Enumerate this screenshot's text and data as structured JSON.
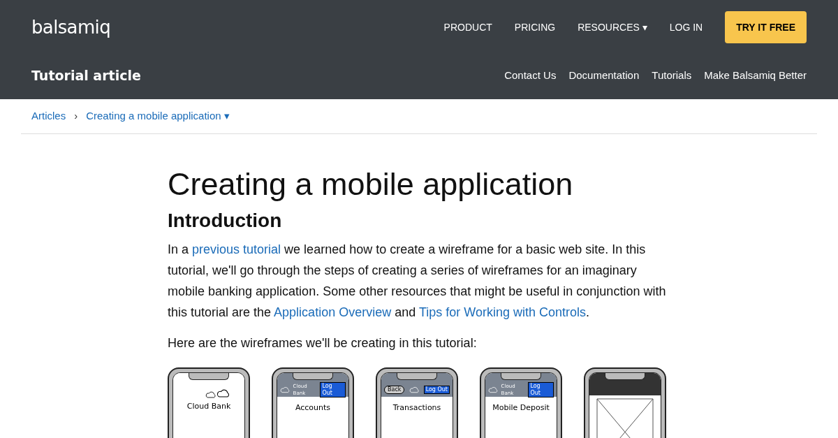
{
  "header": {
    "logo": "balsamiq",
    "nav": [
      "PRODUCT",
      "PRICING",
      "RESOURCES ▾",
      "LOG IN"
    ],
    "cta": "TRY IT FREE"
  },
  "subheader": {
    "title": "Tutorial article",
    "links": [
      "Contact Us",
      "Documentation",
      "Tutorials",
      "Make Balsamiq Better"
    ]
  },
  "breadcrumb": {
    "items": [
      "Articles",
      "Creating a mobile application ▾"
    ],
    "separator": "›"
  },
  "article": {
    "title": "Creating a mobile application",
    "heading": "Introduction",
    "paragraphs": [
      [
        {
          "kind": "text",
          "text": "In a "
        },
        {
          "kind": "link",
          "text": "previous tutorial"
        },
        {
          "kind": "text",
          "text": " we learned how to create a wireframe for a basic web site. In this tutorial, we'll go through the steps of creating a series of wireframes for an imaginary mobile banking application. Some other resources that might be useful in conjunction with this tutorial are the "
        },
        {
          "kind": "link",
          "text": "Application Overview"
        },
        {
          "kind": "text",
          "text": " and "
        },
        {
          "kind": "link",
          "text": "Tips for Working with Controls"
        },
        {
          "kind": "text",
          "text": "."
        }
      ],
      [
        {
          "kind": "text",
          "text": "Here are the wireframes we'll be creating in this tutorial:"
        }
      ]
    ],
    "phones": [
      {
        "kind": "splash",
        "title": "Cloud Bank"
      },
      {
        "kind": "header",
        "brand": "Cloud Bank",
        "button": "Log Out",
        "title": "Accounts"
      },
      {
        "kind": "back",
        "back": "Back",
        "button": "Log Out",
        "title": "Transactions"
      },
      {
        "kind": "header",
        "brand": "Cloud Bank",
        "button": "Log Out",
        "title": "Mobile Deposit"
      },
      {
        "kind": "camera"
      }
    ]
  }
}
